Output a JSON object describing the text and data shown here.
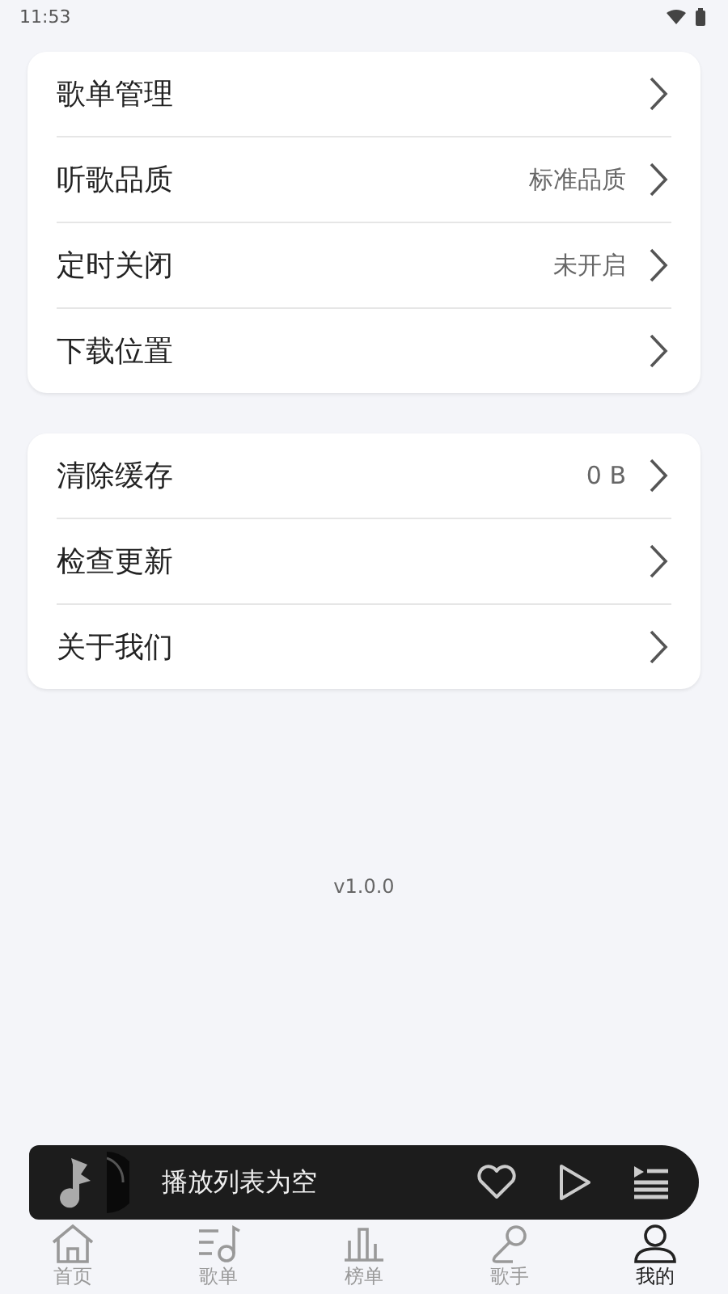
{
  "status_bar": {
    "time": "11:53"
  },
  "groups": [
    {
      "items": [
        {
          "label": "歌单管理"
        },
        {
          "label": "听歌品质",
          "value": "标准品质"
        },
        {
          "label": "定时关闭",
          "value": "未开启"
        },
        {
          "label": "下载位置"
        }
      ]
    },
    {
      "items": [
        {
          "label": "清除缓存",
          "value": "0 B"
        },
        {
          "label": "检查更新"
        },
        {
          "label": "关于我们"
        }
      ]
    }
  ],
  "version": "v1.0.0",
  "player": {
    "status": "播放列表为空",
    "liked": false
  },
  "nav": [
    {
      "label": "首页",
      "selected": false
    },
    {
      "label": "歌单",
      "selected": false
    },
    {
      "label": "榜单",
      "selected": false
    },
    {
      "label": "歌手",
      "selected": false
    },
    {
      "label": "我的",
      "selected": true
    }
  ]
}
